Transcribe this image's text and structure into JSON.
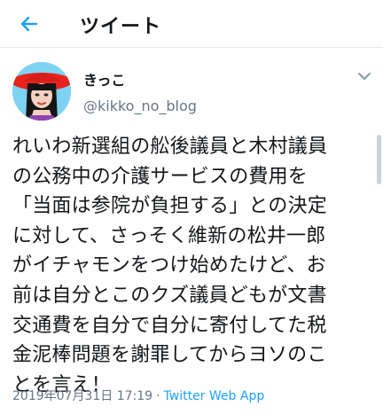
{
  "header": {
    "title": "ツイート",
    "back_icon": "arrow-left-icon",
    "accent": "#1da1f2"
  },
  "tweet": {
    "display_name": "きっこ",
    "handle": "@kikko_no_blog",
    "text": "れいわ新選組の舩後議員と木村議員\nの公務中の介護サービスの費用を\n「当面は参院が負担する」との決定\nに対して、さっそく維新の松井一郎\nがイチャモンをつけ始めたけど、お\n前は自分とこのクズ議員どもが文書\n交通費を自分で自分に寄付してた税\n金泥棒問題を謝罪してからヨソのこ\nとを言え！",
    "timestamp": "2019年07月31日 17:19",
    "separator": "·",
    "source": "Twitter Web App",
    "more_icon": "chevron-down-icon"
  }
}
